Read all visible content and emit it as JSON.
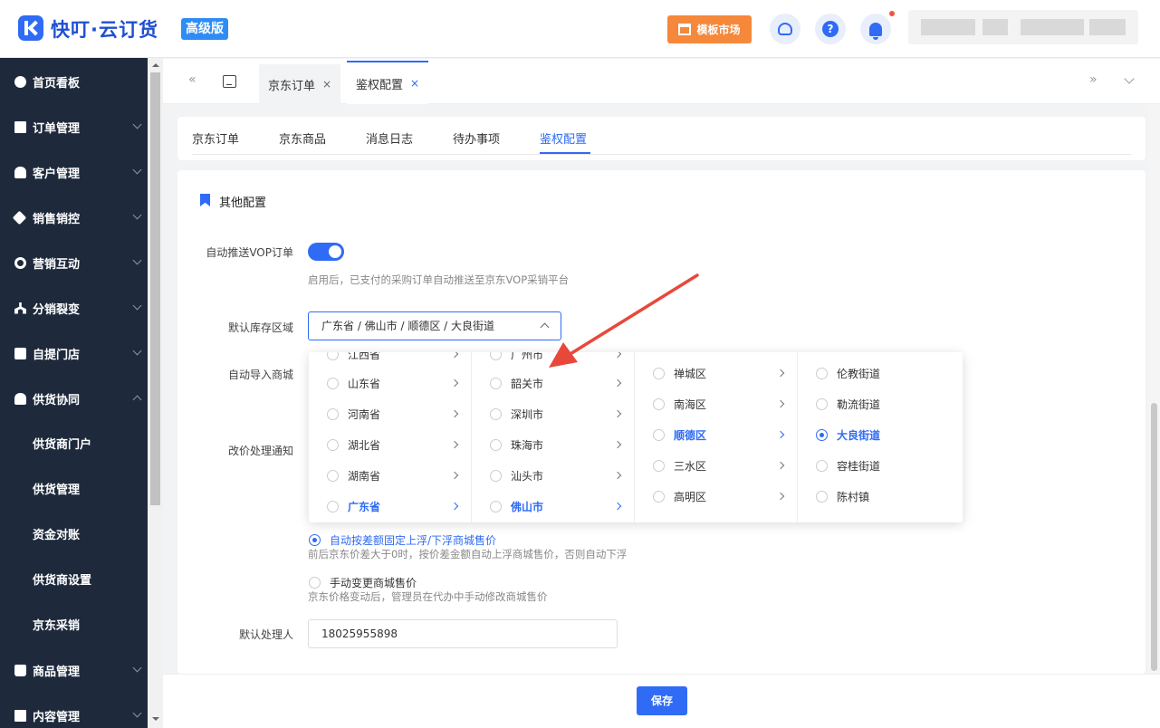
{
  "header": {
    "brand": "快叮·云订货",
    "edition": "高级版",
    "market_button": "模板市场",
    "help_icon": "?"
  },
  "sidebar": {
    "items": [
      {
        "label": "首页看板",
        "icon": "dashboard-icon"
      },
      {
        "label": "订单管理",
        "icon": "document-icon"
      },
      {
        "label": "客户管理",
        "icon": "user-icon"
      },
      {
        "label": "销售销控",
        "icon": "tag-icon"
      },
      {
        "label": "营销互动",
        "icon": "target-icon"
      },
      {
        "label": "分销裂变",
        "icon": "tree-icon"
      },
      {
        "label": "自提门店",
        "icon": "store-icon"
      },
      {
        "label": "供货协同",
        "icon": "supply-icon"
      }
    ],
    "sub_items": [
      "供货商门户",
      "供货管理",
      "资金对账",
      "供货商设置",
      "京东采销"
    ],
    "bottom_items": [
      {
        "label": "商品管理",
        "icon": "bag-icon"
      },
      {
        "label": "内容管理",
        "icon": "document-icon"
      }
    ]
  },
  "page_tabs": [
    {
      "label": "京东订单",
      "close": "×"
    },
    {
      "label": "鉴权配置",
      "close": "×"
    }
  ],
  "inner_tabs": [
    "京东订单",
    "京东商品",
    "消息日志",
    "待办事项",
    "鉴权配置"
  ],
  "section_title": "其他配置",
  "form": {
    "auto_push_label": "自动推送VOP订单",
    "auto_push_hint": "启用后，已支付的采购订单自动推送至京东VOP采销平台",
    "stock_area_label": "默认库存区域",
    "stock_area_value": "广东省 / 佛山市 / 顺德区 / 大良街道",
    "auto_import_label": "自动导入商城",
    "price_notice_label": "改价处理通知",
    "price_option_auto": "自动按差额固定上浮/下浮商城售价",
    "price_option_auto_hint": "前后京东价差大于0时，按价差金额自动上浮商城售价，否则自动下浮",
    "price_option_manual": "手动变更商城售价",
    "price_option_manual_hint": "京东价格变动后，管理员在代办中手动修改商城售价",
    "handler_label": "默认处理人",
    "handler_value": "18025955898",
    "save_button": "保存"
  },
  "cascader": {
    "provinces": [
      "江西省",
      "山东省",
      "河南省",
      "湖北省",
      "湖南省",
      "广东省"
    ],
    "cities": [
      "广州市",
      "韶关市",
      "深圳市",
      "珠海市",
      "汕头市",
      "佛山市"
    ],
    "districts": [
      "禅城区",
      "南海区",
      "顺德区",
      "三水区",
      "高明区"
    ],
    "streets": [
      "伦教街道",
      "勒流街道",
      "大良街道",
      "容桂街道",
      "陈村镇"
    ],
    "selected": {
      "province": "广东省",
      "city": "佛山市",
      "district": "顺德区",
      "street": "大良街道"
    }
  },
  "colors": {
    "accent": "#2f6bf5",
    "sidebar_bg": "#1e2a3c",
    "market_orange": "#f5883a",
    "annotation_red": "#e8483a"
  }
}
